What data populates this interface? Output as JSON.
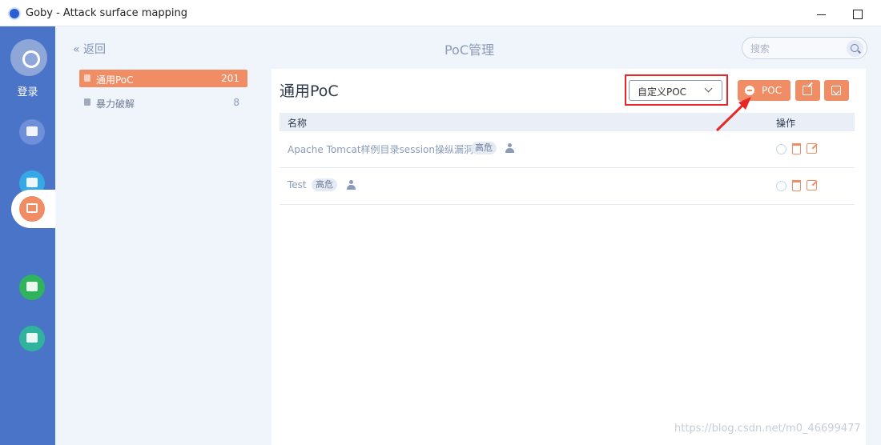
{
  "window": {
    "title": "Goby - Attack surface mapping"
  },
  "rail": {
    "login_label": "登录"
  },
  "header": {
    "back_label": "返回",
    "page_title": "PoC管理",
    "search_placeholder": "搜索"
  },
  "categories": [
    {
      "label": "通用PoC",
      "count": "201",
      "active": true
    },
    {
      "label": "暴力破解",
      "count": "8",
      "active": false
    }
  ],
  "panel": {
    "title": "通用PoC",
    "filter_value": "自定义POC",
    "poc_button_label": "POC",
    "columns": {
      "name": "名称",
      "ops": "操作"
    },
    "rows": [
      {
        "name": "Apache Tomcat样例目录session操纵漏洞",
        "severity": "高危"
      },
      {
        "name": "Test",
        "severity": "高危"
      }
    ]
  },
  "watermark": "https://blog.csdn.net/m0_46699477",
  "colors": {
    "accent": "#f18d65",
    "rail": "#4a74c8",
    "highlight_box": "#e82727"
  }
}
